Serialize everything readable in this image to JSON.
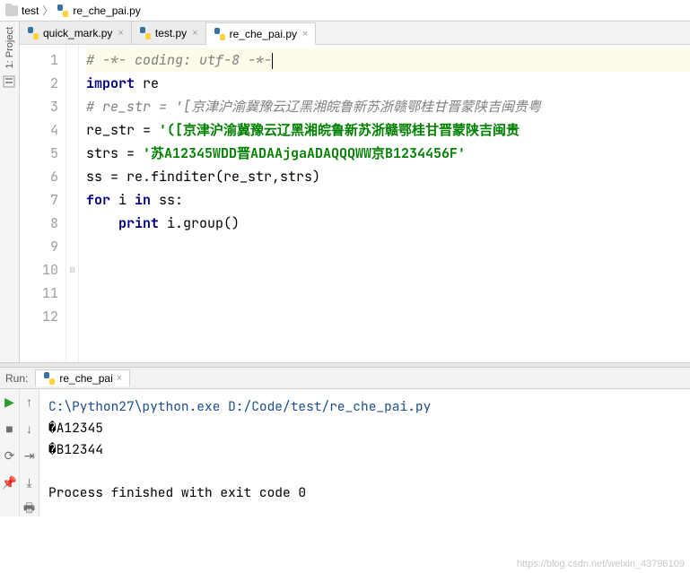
{
  "breadcrumb": {
    "folder": "test",
    "file": "re_che_pai.py"
  },
  "sidebar": {
    "label": "1: Project"
  },
  "tabs": [
    {
      "label": "quick_mark.py",
      "active": false
    },
    {
      "label": "test.py",
      "active": false
    },
    {
      "label": "re_che_pai.py",
      "active": true
    }
  ],
  "code": {
    "lines": [
      {
        "n": 1,
        "hl": true,
        "segs": [
          {
            "t": "# -*- coding: utf-8 -*-",
            "cls": "comment"
          }
        ],
        "cursorEnd": true
      },
      {
        "n": 2,
        "segs": [
          {
            "t": "import",
            "cls": "kw"
          },
          {
            "t": " re"
          }
        ]
      },
      {
        "n": 3,
        "segs": [
          {
            "t": "# re_str = '[京津沪渝冀豫云辽黑湘皖鲁新苏浙赣鄂桂甘晋蒙陕吉闽贵粤",
            "cls": "comment"
          }
        ]
      },
      {
        "n": 4,
        "segs": [
          {
            "t": "re_str = "
          },
          {
            "t": "'([京津沪渝冀豫云辽黑湘皖鲁新苏浙赣鄂桂甘晋蒙陕吉闽贵",
            "cls": "str"
          }
        ]
      },
      {
        "n": 5,
        "segs": [
          {
            "t": ""
          }
        ]
      },
      {
        "n": 6,
        "segs": [
          {
            "t": "strs = "
          },
          {
            "t": "'苏A12345WDD晋ADAAjgaADAQQQWW京B1234456F'",
            "cls": "str"
          }
        ]
      },
      {
        "n": 7,
        "segs": [
          {
            "t": ""
          }
        ]
      },
      {
        "n": 8,
        "segs": [
          {
            "t": "ss = re.finditer(re_str,strs)"
          }
        ]
      },
      {
        "n": 9,
        "segs": [
          {
            "t": ""
          }
        ]
      },
      {
        "n": 10,
        "fold": true,
        "segs": [
          {
            "t": "for",
            "cls": "kw"
          },
          {
            "t": " i "
          },
          {
            "t": "in",
            "cls": "kw"
          },
          {
            "t": " ss:"
          }
        ]
      },
      {
        "n": 11,
        "segs": [
          {
            "t": "    "
          },
          {
            "t": "print",
            "cls": "kw"
          },
          {
            "t": " i.group()"
          }
        ]
      },
      {
        "n": 12,
        "segs": [
          {
            "t": ""
          }
        ]
      }
    ]
  },
  "run": {
    "label": "Run:",
    "tab": "re_che_pai",
    "console": {
      "command": "C:\\Python27\\python.exe D:/Code/test/re_che_pai.py",
      "out1": "�A12345",
      "out2": "�B12344",
      "blank": "",
      "exit": "Process finished with exit code 0"
    }
  },
  "watermark": "https://blog.csdn.net/weixin_43796109"
}
